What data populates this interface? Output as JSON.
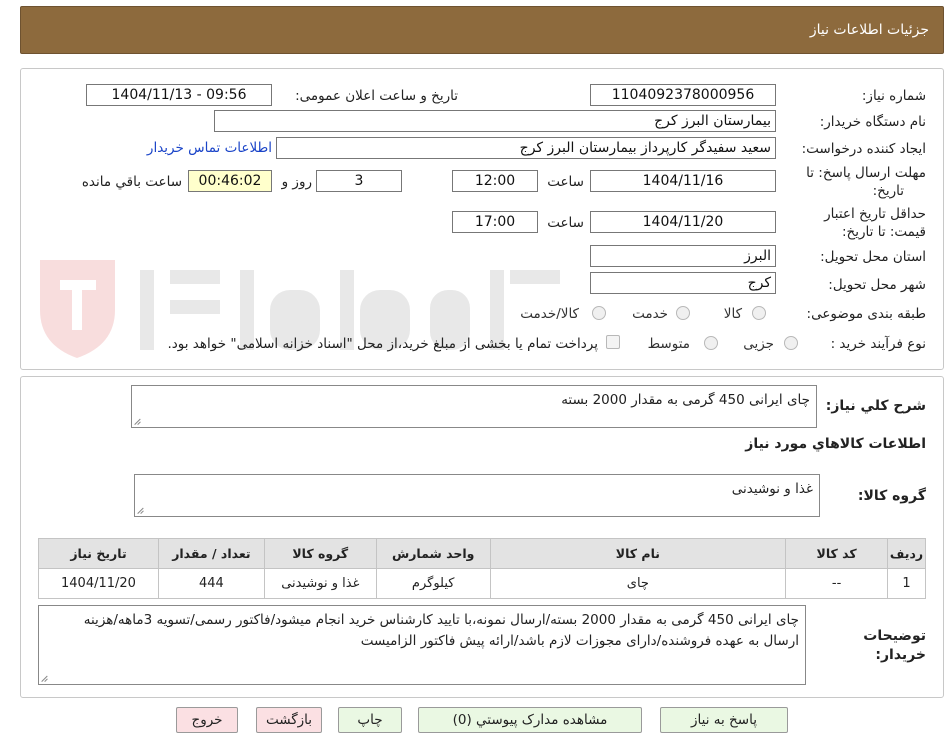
{
  "header": {
    "title": "جزئیات اطلاعات نیاز"
  },
  "form": {
    "need_number_label": "شماره نیاز:",
    "need_number": "1104092378000956",
    "announce_label": "تاریخ و ساعت اعلان عمومی:",
    "announce_value": "1404/11/13 - 09:56",
    "buyer_org_label": "نام دستگاه خریدار:",
    "buyer_org": "بیمارستان البرز کرج",
    "requester_label": "ایجاد کننده درخواست:",
    "requester": "سعید سفیدگر کارپرداز بیمارستان البرز کرج",
    "contact_link": "اطلاعات تماس خریدار",
    "deadline_label_1": "مهلت ارسال پاسخ: تا",
    "deadline_label_2": "تاریخ:",
    "deadline_date": "1404/11/16",
    "time_label": "ساعت",
    "deadline_time": "12:00",
    "days_value": "3",
    "days_label": "روز و",
    "remaining_time": "00:46:02",
    "remaining_label": "ساعت باقي مانده",
    "validity_label_1": "حداقل تاریخ اعتبار",
    "validity_label_2": "قیمت: تا تاریخ:",
    "validity_date": "1404/11/20",
    "validity_time": "17:00",
    "province_label": "استان محل تحویل:",
    "province": "البرز",
    "city_label": "شهر محل تحویل:",
    "city": "کرج",
    "category_label": "طبقه بندی موضوعی:",
    "category_options": [
      "کالا",
      "خدمت",
      "کالا/خدمت"
    ],
    "process_label": "نوع فرآیند خرید :",
    "process_options": [
      "جزیی",
      "متوسط"
    ],
    "payment_note": "پرداخت تمام یا بخشی از مبلغ خرید،از محل \"اسناد خزانه اسلامی\" خواهد بود."
  },
  "description": {
    "label": "شرح کلي نياز:",
    "value": "چای ایرانی 450 گرمی به مقدار 2000 بسته"
  },
  "goods": {
    "section_title": "اطلاعات کالاهاي مورد نياز",
    "group_label": "گروه کالا:",
    "group_value": "غذا و نوشیدنی",
    "table": {
      "headers": [
        "رديف",
        "کد کالا",
        "نام کالا",
        "واحد شمارش",
        "گروه کالا",
        "تعداد / مقدار",
        "تاریخ نیاز"
      ],
      "rows": [
        [
          "1",
          "--",
          "چای",
          "کیلوگرم",
          "غذا و نوشیدنی",
          "444",
          "1404/11/20"
        ]
      ]
    },
    "notes_label_1": "توضیحات",
    "notes_label_2": "خریدار:",
    "notes_value": "چای ایرانی 450 گرمی به مقدار 2000 بسته/ارسال نمونه،با تایید کارشناس خرید انجام میشود/فاکتور رسمی/تسویه 3ماهه/هزینه ارسال به عهده فروشنده/دارای مجوزات لازم باشد/ارائه پیش فاکتور الزامیست"
  },
  "buttons": {
    "reply": "پاسخ به نیاز",
    "attachments": "مشاهده مدارک پیوستي (0)",
    "print": "چاپ",
    "back": "بازگشت",
    "exit": "خروج"
  },
  "colors": {
    "header_bg": "#8d6a3d",
    "link": "#1a44c8",
    "green_button": "#eaf8e3",
    "pink_button": "#fbe0e3",
    "timer_bg": "#ffffcc"
  }
}
